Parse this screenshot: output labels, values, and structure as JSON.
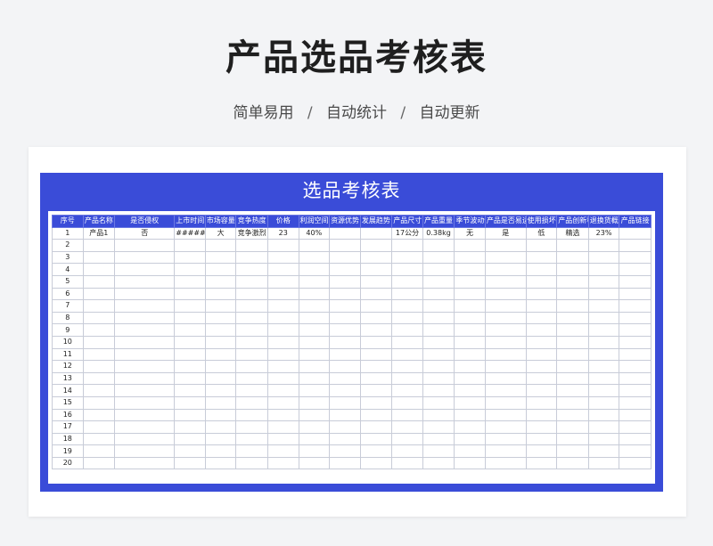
{
  "page": {
    "title": "产品选品考核表",
    "subtitle_parts": [
      "简单易用",
      "自动统计",
      "自动更新"
    ],
    "separator": "/"
  },
  "sheet": {
    "title": "选品考核表",
    "columns": [
      "序号",
      "产品名称",
      "是否侵权",
      "上市时间",
      "市场容量",
      "竞争热度",
      "价格",
      "利润空间",
      "资源优势",
      "发展趋势",
      "产品尺寸",
      "产品重量",
      "季节波动性",
      "产品是否易运输",
      "使用损坏概率",
      "产品创新程度",
      "退换货概率",
      "产品链接"
    ],
    "rows": [
      [
        "1",
        "产品1",
        "否",
        "#######",
        "大",
        "竞争激烈",
        "23",
        "40%",
        "",
        "",
        "17公分",
        "0.38kg",
        "无",
        "是",
        "低",
        "精选",
        "23%",
        ""
      ],
      [
        "2",
        "",
        "",
        "",
        "",
        "",
        "",
        "",
        "",
        "",
        "",
        "",
        "",
        "",
        "",
        "",
        "",
        ""
      ],
      [
        "3",
        "",
        "",
        "",
        "",
        "",
        "",
        "",
        "",
        "",
        "",
        "",
        "",
        "",
        "",
        "",
        "",
        ""
      ],
      [
        "4",
        "",
        "",
        "",
        "",
        "",
        "",
        "",
        "",
        "",
        "",
        "",
        "",
        "",
        "",
        "",
        "",
        ""
      ],
      [
        "5",
        "",
        "",
        "",
        "",
        "",
        "",
        "",
        "",
        "",
        "",
        "",
        "",
        "",
        "",
        "",
        "",
        ""
      ],
      [
        "6",
        "",
        "",
        "",
        "",
        "",
        "",
        "",
        "",
        "",
        "",
        "",
        "",
        "",
        "",
        "",
        "",
        ""
      ],
      [
        "7",
        "",
        "",
        "",
        "",
        "",
        "",
        "",
        "",
        "",
        "",
        "",
        "",
        "",
        "",
        "",
        "",
        ""
      ],
      [
        "8",
        "",
        "",
        "",
        "",
        "",
        "",
        "",
        "",
        "",
        "",
        "",
        "",
        "",
        "",
        "",
        "",
        ""
      ],
      [
        "9",
        "",
        "",
        "",
        "",
        "",
        "",
        "",
        "",
        "",
        "",
        "",
        "",
        "",
        "",
        "",
        "",
        ""
      ],
      [
        "10",
        "",
        "",
        "",
        "",
        "",
        "",
        "",
        "",
        "",
        "",
        "",
        "",
        "",
        "",
        "",
        "",
        ""
      ],
      [
        "11",
        "",
        "",
        "",
        "",
        "",
        "",
        "",
        "",
        "",
        "",
        "",
        "",
        "",
        "",
        "",
        "",
        ""
      ],
      [
        "12",
        "",
        "",
        "",
        "",
        "",
        "",
        "",
        "",
        "",
        "",
        "",
        "",
        "",
        "",
        "",
        "",
        ""
      ],
      [
        "13",
        "",
        "",
        "",
        "",
        "",
        "",
        "",
        "",
        "",
        "",
        "",
        "",
        "",
        "",
        "",
        "",
        ""
      ],
      [
        "14",
        "",
        "",
        "",
        "",
        "",
        "",
        "",
        "",
        "",
        "",
        "",
        "",
        "",
        "",
        "",
        "",
        ""
      ],
      [
        "15",
        "",
        "",
        "",
        "",
        "",
        "",
        "",
        "",
        "",
        "",
        "",
        "",
        "",
        "",
        "",
        "",
        ""
      ],
      [
        "16",
        "",
        "",
        "",
        "",
        "",
        "",
        "",
        "",
        "",
        "",
        "",
        "",
        "",
        "",
        "",
        "",
        ""
      ],
      [
        "17",
        "",
        "",
        "",
        "",
        "",
        "",
        "",
        "",
        "",
        "",
        "",
        "",
        "",
        "",
        "",
        "",
        ""
      ],
      [
        "18",
        "",
        "",
        "",
        "",
        "",
        "",
        "",
        "",
        "",
        "",
        "",
        "",
        "",
        "",
        "",
        "",
        ""
      ],
      [
        "19",
        "",
        "",
        "",
        "",
        "",
        "",
        "",
        "",
        "",
        "",
        "",
        "",
        "",
        "",
        "",
        "",
        ""
      ],
      [
        "20",
        "",
        "",
        "",
        "",
        "",
        "",
        "",
        "",
        "",
        "",
        "",
        "",
        "",
        "",
        "",
        "",
        ""
      ]
    ]
  },
  "colors": {
    "header_bg": "#3a4cd8",
    "page_bg": "#f3f4f6",
    "grid": "#c8ccd8"
  }
}
